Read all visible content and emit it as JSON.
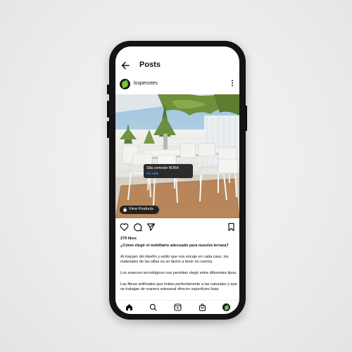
{
  "header": {
    "title": "Posts"
  },
  "post": {
    "username": "lospenotes",
    "tag": {
      "product": "Silla comedor NORA",
      "status": "On sale"
    },
    "view_products_label": "View Products",
    "likes": "279 likes",
    "caption_heading": "¿Cómo elegir el mobiliario adecuado para nuestra terraza?",
    "paragraphs": [
      "Al margen del diseño y estilo que nos encaje en cada caso, los materiales de las sillas es un factor a tener en cuenta.",
      "Los avances tecnológicos nos permiten elegir entre diferentes tipos.",
      "Las fibras artificiales que imitan perfectamente a las naturales y que se trabajan de manera artesanal ofrecen superficies lisas"
    ]
  },
  "icons": {
    "back": "arrow-left-icon",
    "more": "more-vertical-icon",
    "like": "heart-icon",
    "comment": "comment-icon",
    "share": "send-icon",
    "save": "bookmark-icon",
    "nav": [
      "home-icon",
      "search-icon",
      "reels-icon",
      "shop-icon",
      "profile-icon"
    ]
  },
  "colors": {
    "brand_green": "#7cc23f",
    "link_blue": "#4aa3ff"
  }
}
